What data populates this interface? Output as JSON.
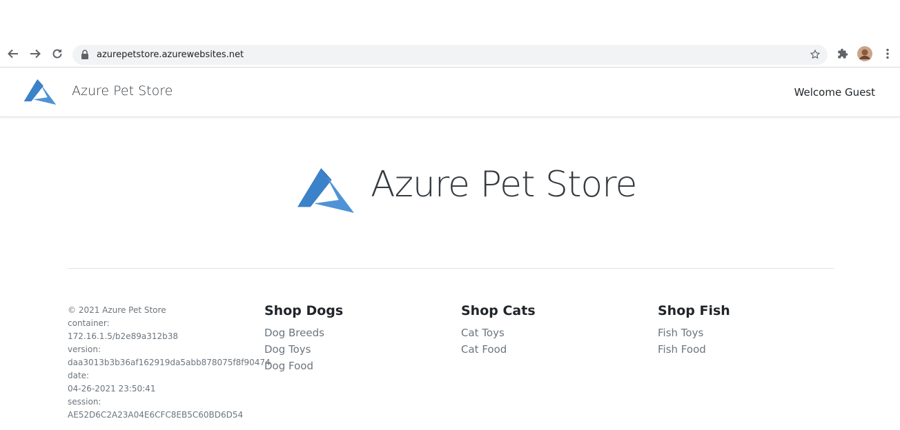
{
  "browser": {
    "url": "azurepetstore.azurewebsites.net"
  },
  "header": {
    "brand_title": "Azure Pet Store",
    "welcome_text": "Welcome Guest"
  },
  "hero": {
    "title": "Azure Pet Store"
  },
  "footer": {
    "info_lines": [
      "© 2021 Azure Pet Store",
      "container:",
      "172.16.1.5/b2e89a312b38",
      "version:",
      "daa3013b3b36af162919da5abb878075f8f90474",
      "date:",
      "04-26-2021 23:50:41",
      "session:",
      "AE52D6C2A23A04E6CFC8EB5C60BD6D54"
    ],
    "columns": [
      {
        "heading": "Shop Dogs",
        "links": [
          "Dog Breeds",
          "Dog Toys",
          "Dog Food"
        ]
      },
      {
        "heading": "Shop Cats",
        "links": [
          "Cat Toys",
          "Cat Food"
        ]
      },
      {
        "heading": "Shop Fish",
        "links": [
          "Fish Toys",
          "Fish Food"
        ]
      }
    ]
  },
  "colors": {
    "azure_blue": "#3b82c8",
    "link_gray": "#6c757d"
  }
}
